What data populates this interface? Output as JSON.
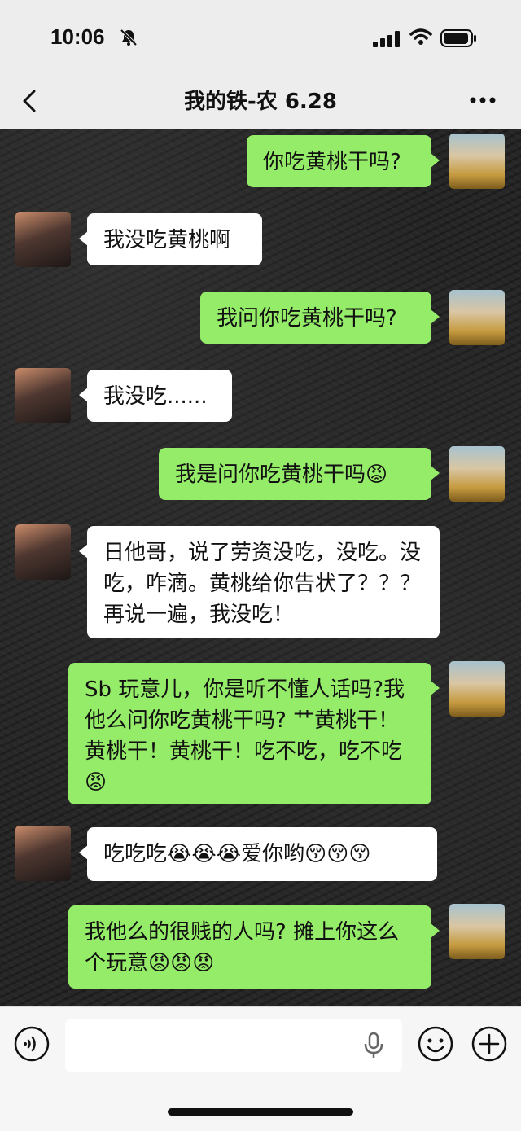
{
  "status_bar": {
    "time": "10:06"
  },
  "nav": {
    "title": "我的铁-农 6.28"
  },
  "messages": [
    {
      "side": "right",
      "text": "你吃黄桃干吗?"
    },
    {
      "side": "left",
      "text": "我没吃黄桃啊"
    },
    {
      "side": "right",
      "text": "我问你吃黄桃干吗?"
    },
    {
      "side": "left",
      "text": "我没吃......"
    },
    {
      "side": "right",
      "text": "我是问你吃黄桃干吗😡"
    },
    {
      "side": "left",
      "text": "日他哥，说了劳资没吃，没吃。没吃，咋滴。黄桃给你告状了？？？再说一遍，我没吃！"
    },
    {
      "side": "right",
      "text": "Sb 玩意儿，你是听不懂人话吗?我他么问你吃黄桃干吗? 艹黄桃干！黄桃干！黄桃干！吃不吃，吃不吃😡"
    },
    {
      "side": "left",
      "text": "吃吃吃😭😭😭爱你哟😚😚😚"
    },
    {
      "side": "right",
      "text": "我他么的很贱的人吗? 摊上你这么个玩意😡😡😡"
    }
  ],
  "colors": {
    "bubble_right": "#95ec69",
    "bubble_left": "#ffffff",
    "chrome": "#ededed"
  },
  "icons": {
    "voice": "voice-icon",
    "mic": "microphone-icon",
    "emoji": "emoji-icon",
    "plus": "plus-icon"
  }
}
